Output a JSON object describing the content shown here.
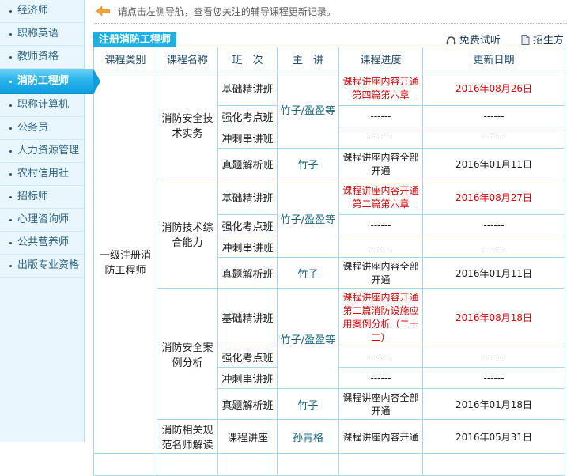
{
  "sidebar": {
    "items": [
      {
        "label": "经济师",
        "active": false
      },
      {
        "label": "职称英语",
        "active": false
      },
      {
        "label": "教师资格",
        "active": false
      },
      {
        "label": "消防工程师",
        "active": true
      },
      {
        "label": "职称计算机",
        "active": false
      },
      {
        "label": "公务员",
        "active": false
      },
      {
        "label": "人力资源管理",
        "active": false
      },
      {
        "label": "农村信用社",
        "active": false
      },
      {
        "label": "招标师",
        "active": false
      },
      {
        "label": "心理咨询师",
        "active": false
      },
      {
        "label": "公共营养师",
        "active": false
      },
      {
        "label": "出版专业资格",
        "active": false
      }
    ]
  },
  "notice": {
    "icon": "orange-left-arrow",
    "text": "请点击左侧导航，查看您关注的辅导课程更新记录。"
  },
  "panel": {
    "tab": "注册消防工程师",
    "free_trial": "免费试听",
    "enrollment": "招生方"
  },
  "colors": {
    "accent_blue": "#1ab0e8",
    "alert_red": "#e60000",
    "teacher_teal": "#1a6880",
    "table_border_blue": "#a4d9f1",
    "sidebar_bg": "#e9f6fd"
  },
  "table": {
    "headers": [
      "课程类别",
      "课程名称",
      "班　次",
      "主　讲",
      "课程进度",
      "更新日期"
    ],
    "category": "一级注册消防工程师",
    "groups": [
      {
        "course": "消防安全技术实务",
        "rows": [
          {
            "class_name": "基础精讲班",
            "teacher": "竹子/盈盈等",
            "progress": "课程讲座内容开通第四篇第六章",
            "date": "2016年08月26日",
            "highlight": true
          },
          {
            "class_name": "强化考点班",
            "progress": "------",
            "date": "------",
            "highlight": false
          },
          {
            "class_name": "冲刺串讲班",
            "progress": "------",
            "date": "------",
            "highlight": false
          },
          {
            "class_name": "真题解析班",
            "teacher": "竹子",
            "progress": "课程讲座内容全部开通",
            "date": "2016年01月11日",
            "highlight": false
          }
        ]
      },
      {
        "course": "消防技术综合能力",
        "rows": [
          {
            "class_name": "基础精讲班",
            "teacher": "竹子/盈盈等",
            "progress": "课程讲座内容开通第二篇第六章",
            "date": "2016年08月27日",
            "highlight": true
          },
          {
            "class_name": "强化考点班",
            "progress": "------",
            "date": "------",
            "highlight": false
          },
          {
            "class_name": "冲刺串讲班",
            "progress": "------",
            "date": "------",
            "highlight": false
          },
          {
            "class_name": "真题解析班",
            "teacher": "竹子",
            "progress": "课程讲座内容全部开通",
            "date": "2016年01月11日",
            "highlight": false
          }
        ]
      },
      {
        "course": "消防安全案例分析",
        "rows": [
          {
            "class_name": "基础精讲班",
            "teacher": "竹子/盈盈等",
            "progress": "课程讲座内容开通第二篇消防设施应用案例分析（二十二）",
            "date": "2016年08月18日",
            "highlight": true
          },
          {
            "class_name": "强化考点班",
            "progress": "------",
            "date": "------",
            "highlight": false
          },
          {
            "class_name": "冲刺串讲班",
            "progress": "------",
            "date": "------",
            "highlight": false
          },
          {
            "class_name": "真题解析班",
            "teacher": "竹子",
            "progress": "课程讲座内容全部开通",
            "date": "2016年01月18日",
            "highlight": false
          }
        ]
      },
      {
        "course": "消防相关规范名师解读",
        "rows": [
          {
            "class_name": "课程讲座",
            "teacher": "孙青格",
            "progress": "课程讲座内容开通",
            "date": "2016年05月31日",
            "highlight": false
          }
        ]
      }
    ]
  }
}
